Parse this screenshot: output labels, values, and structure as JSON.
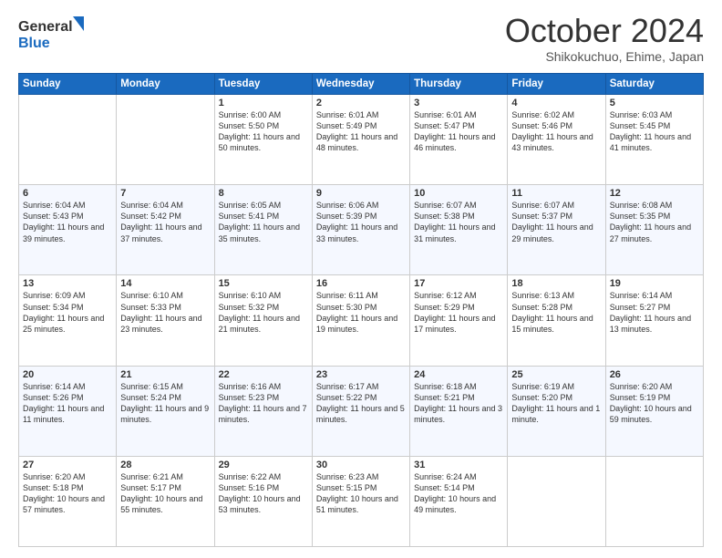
{
  "header": {
    "logo_line1": "General",
    "logo_line2": "Blue",
    "month": "October 2024",
    "location": "Shikokuchuo, Ehime, Japan"
  },
  "days_of_week": [
    "Sunday",
    "Monday",
    "Tuesday",
    "Wednesday",
    "Thursday",
    "Friday",
    "Saturday"
  ],
  "weeks": [
    [
      {
        "day": "",
        "empty": true
      },
      {
        "day": "",
        "empty": true
      },
      {
        "day": "1",
        "sunrise": "6:00 AM",
        "sunset": "5:50 PM",
        "daylight": "11 hours and 50 minutes."
      },
      {
        "day": "2",
        "sunrise": "6:01 AM",
        "sunset": "5:49 PM",
        "daylight": "11 hours and 48 minutes."
      },
      {
        "day": "3",
        "sunrise": "6:01 AM",
        "sunset": "5:47 PM",
        "daylight": "11 hours and 46 minutes."
      },
      {
        "day": "4",
        "sunrise": "6:02 AM",
        "sunset": "5:46 PM",
        "daylight": "11 hours and 43 minutes."
      },
      {
        "day": "5",
        "sunrise": "6:03 AM",
        "sunset": "5:45 PM",
        "daylight": "11 hours and 41 minutes."
      }
    ],
    [
      {
        "day": "6",
        "sunrise": "6:04 AM",
        "sunset": "5:43 PM",
        "daylight": "11 hours and 39 minutes."
      },
      {
        "day": "7",
        "sunrise": "6:04 AM",
        "sunset": "5:42 PM",
        "daylight": "11 hours and 37 minutes."
      },
      {
        "day": "8",
        "sunrise": "6:05 AM",
        "sunset": "5:41 PM",
        "daylight": "11 hours and 35 minutes."
      },
      {
        "day": "9",
        "sunrise": "6:06 AM",
        "sunset": "5:39 PM",
        "daylight": "11 hours and 33 minutes."
      },
      {
        "day": "10",
        "sunrise": "6:07 AM",
        "sunset": "5:38 PM",
        "daylight": "11 hours and 31 minutes."
      },
      {
        "day": "11",
        "sunrise": "6:07 AM",
        "sunset": "5:37 PM",
        "daylight": "11 hours and 29 minutes."
      },
      {
        "day": "12",
        "sunrise": "6:08 AM",
        "sunset": "5:35 PM",
        "daylight": "11 hours and 27 minutes."
      }
    ],
    [
      {
        "day": "13",
        "sunrise": "6:09 AM",
        "sunset": "5:34 PM",
        "daylight": "11 hours and 25 minutes."
      },
      {
        "day": "14",
        "sunrise": "6:10 AM",
        "sunset": "5:33 PM",
        "daylight": "11 hours and 23 minutes."
      },
      {
        "day": "15",
        "sunrise": "6:10 AM",
        "sunset": "5:32 PM",
        "daylight": "11 hours and 21 minutes."
      },
      {
        "day": "16",
        "sunrise": "6:11 AM",
        "sunset": "5:30 PM",
        "daylight": "11 hours and 19 minutes."
      },
      {
        "day": "17",
        "sunrise": "6:12 AM",
        "sunset": "5:29 PM",
        "daylight": "11 hours and 17 minutes."
      },
      {
        "day": "18",
        "sunrise": "6:13 AM",
        "sunset": "5:28 PM",
        "daylight": "11 hours and 15 minutes."
      },
      {
        "day": "19",
        "sunrise": "6:14 AM",
        "sunset": "5:27 PM",
        "daylight": "11 hours and 13 minutes."
      }
    ],
    [
      {
        "day": "20",
        "sunrise": "6:14 AM",
        "sunset": "5:26 PM",
        "daylight": "11 hours and 11 minutes."
      },
      {
        "day": "21",
        "sunrise": "6:15 AM",
        "sunset": "5:24 PM",
        "daylight": "11 hours and 9 minutes."
      },
      {
        "day": "22",
        "sunrise": "6:16 AM",
        "sunset": "5:23 PM",
        "daylight": "11 hours and 7 minutes."
      },
      {
        "day": "23",
        "sunrise": "6:17 AM",
        "sunset": "5:22 PM",
        "daylight": "11 hours and 5 minutes."
      },
      {
        "day": "24",
        "sunrise": "6:18 AM",
        "sunset": "5:21 PM",
        "daylight": "11 hours and 3 minutes."
      },
      {
        "day": "25",
        "sunrise": "6:19 AM",
        "sunset": "5:20 PM",
        "daylight": "11 hours and 1 minute."
      },
      {
        "day": "26",
        "sunrise": "6:20 AM",
        "sunset": "5:19 PM",
        "daylight": "10 hours and 59 minutes."
      }
    ],
    [
      {
        "day": "27",
        "sunrise": "6:20 AM",
        "sunset": "5:18 PM",
        "daylight": "10 hours and 57 minutes."
      },
      {
        "day": "28",
        "sunrise": "6:21 AM",
        "sunset": "5:17 PM",
        "daylight": "10 hours and 55 minutes."
      },
      {
        "day": "29",
        "sunrise": "6:22 AM",
        "sunset": "5:16 PM",
        "daylight": "10 hours and 53 minutes."
      },
      {
        "day": "30",
        "sunrise": "6:23 AM",
        "sunset": "5:15 PM",
        "daylight": "10 hours and 51 minutes."
      },
      {
        "day": "31",
        "sunrise": "6:24 AM",
        "sunset": "5:14 PM",
        "daylight": "10 hours and 49 minutes."
      },
      {
        "day": "",
        "empty": true
      },
      {
        "day": "",
        "empty": true
      }
    ]
  ]
}
